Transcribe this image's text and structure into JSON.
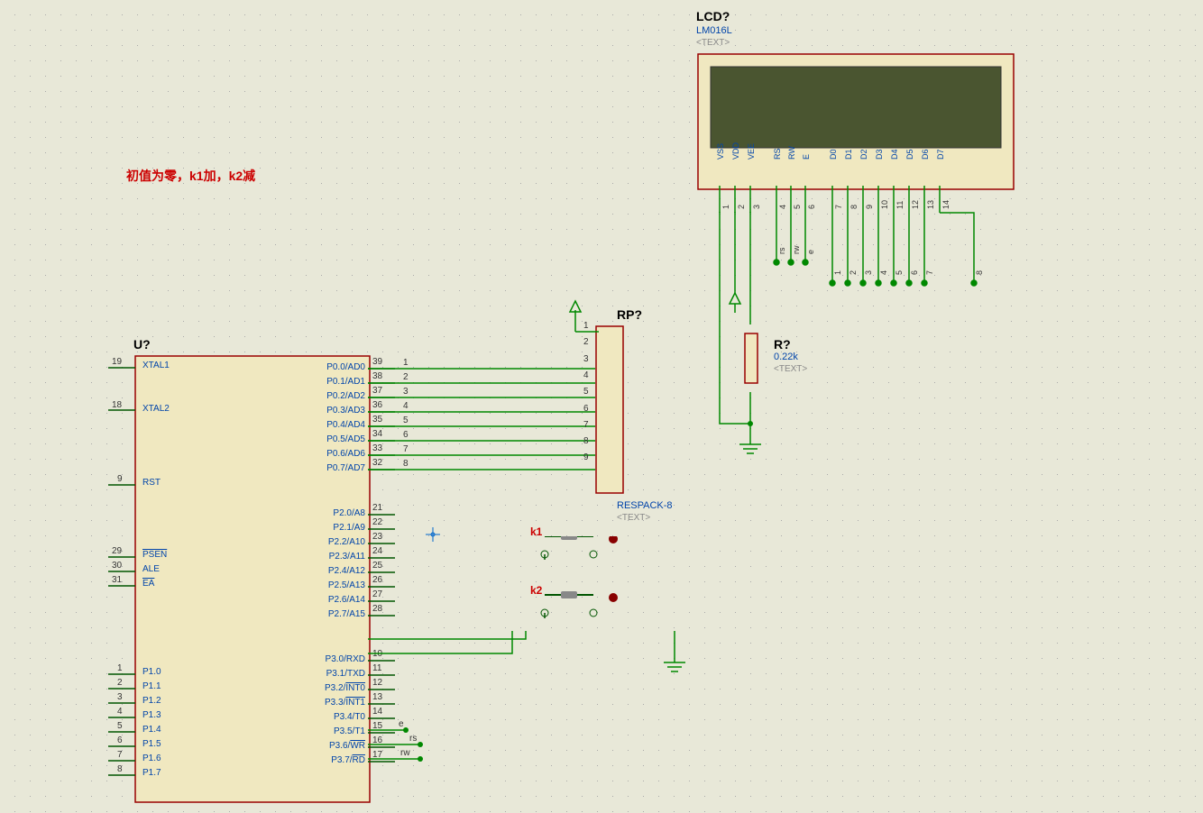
{
  "annotation": "初值为零，k1加，k2减",
  "mcu": {
    "name": "U?",
    "left_pins": [
      {
        "num": "19",
        "label": "XTAL1"
      },
      {
        "num": "18",
        "label": "XTAL2"
      },
      {
        "num": "9",
        "label": "RST"
      },
      {
        "num": "29",
        "label": "PSEN",
        "ol": true
      },
      {
        "num": "30",
        "label": "ALE"
      },
      {
        "num": "31",
        "label": "EA",
        "ol": true
      },
      {
        "num": "1",
        "label": "P1.0"
      },
      {
        "num": "2",
        "label": "P1.1"
      },
      {
        "num": "3",
        "label": "P1.2"
      },
      {
        "num": "4",
        "label": "P1.3"
      },
      {
        "num": "5",
        "label": "P1.4"
      },
      {
        "num": "6",
        "label": "P1.5"
      },
      {
        "num": "7",
        "label": "P1.6"
      },
      {
        "num": "8",
        "label": "P1.7"
      }
    ],
    "right_pins": [
      {
        "num": "39",
        "label": "P0.0/AD0"
      },
      {
        "num": "38",
        "label": "P0.1/AD1"
      },
      {
        "num": "37",
        "label": "P0.2/AD2"
      },
      {
        "num": "36",
        "label": "P0.3/AD3"
      },
      {
        "num": "35",
        "label": "P0.4/AD4"
      },
      {
        "num": "34",
        "label": "P0.5/AD5"
      },
      {
        "num": "33",
        "label": "P0.6/AD6"
      },
      {
        "num": "32",
        "label": "P0.7/AD7"
      },
      {
        "num": "21",
        "label": "P2.0/A8"
      },
      {
        "num": "22",
        "label": "P2.1/A9"
      },
      {
        "num": "23",
        "label": "P2.2/A10"
      },
      {
        "num": "24",
        "label": "P2.3/A11"
      },
      {
        "num": "25",
        "label": "P2.4/A12"
      },
      {
        "num": "26",
        "label": "P2.5/A13"
      },
      {
        "num": "27",
        "label": "P2.6/A14"
      },
      {
        "num": "28",
        "label": "P2.7/A15"
      },
      {
        "num": "10",
        "label": "P3.0/RXD"
      },
      {
        "num": "11",
        "label": "P3.1/TXD"
      },
      {
        "num": "12",
        "label": "P3.2/INT0",
        "ol": "INT0"
      },
      {
        "num": "13",
        "label": "P3.3/INT1",
        "ol": "INT1"
      },
      {
        "num": "14",
        "label": "P3.4/T0"
      },
      {
        "num": "15",
        "label": "P3.5/T1"
      },
      {
        "num": "16",
        "label": "P3.6/WR",
        "ol": "WR"
      },
      {
        "num": "17",
        "label": "P3.7/RD",
        "ol": "RD"
      }
    ]
  },
  "respack": {
    "name": "RP?",
    "part": "RESPACK-8",
    "text": "<TEXT>",
    "left_nums": [
      "1",
      "2",
      "3",
      "4",
      "5",
      "6",
      "7",
      "8",
      "9"
    ],
    "wire_labels": [
      "1",
      "2",
      "3",
      "4",
      "5",
      "6",
      "7",
      "8"
    ]
  },
  "lcd": {
    "name": "LCD?",
    "part": "LM016L",
    "text": "<TEXT>",
    "pins": [
      "VSS",
      "VDD",
      "VEE",
      "RS",
      "RW",
      "E",
      "D0",
      "D1",
      "D2",
      "D3",
      "D4",
      "D5",
      "D6",
      "D7"
    ],
    "pin_nums": [
      "1",
      "2",
      "3",
      "4",
      "5",
      "6",
      "7",
      "8",
      "9",
      "10",
      "11",
      "12",
      "13",
      "14"
    ],
    "net_labels": [
      "rs",
      "rw",
      "e",
      "1",
      "2",
      "3",
      "4",
      "5",
      "6",
      "7",
      "8"
    ]
  },
  "resistor": {
    "name": "R?",
    "value": "0.22k",
    "text": "<TEXT>"
  },
  "buttons": {
    "k1": "k1",
    "k2": "k2"
  },
  "net_labels_p3": [
    "e",
    "rs",
    "rw"
  ]
}
